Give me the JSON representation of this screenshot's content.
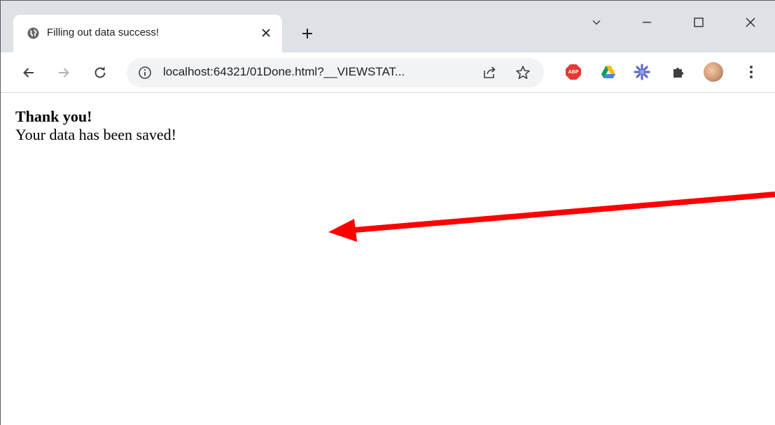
{
  "browser": {
    "tab": {
      "title": "Filling out data success!",
      "favicon": "globe-icon",
      "close_icon": "close-icon"
    },
    "new_tab_icon": "plus-icon",
    "window_controls": [
      "chevron-down-icon",
      "minimize-icon",
      "maximize-icon",
      "close-icon"
    ],
    "toolbar": {
      "back_icon": "back-arrow-icon",
      "forward_icon": "forward-arrow-icon",
      "reload_icon": "reload-icon",
      "address": "localhost:64321/01Done.html?__VIEWSTAT...",
      "site_info_icon": "info-icon",
      "share_icon": "share-icon",
      "bookmark_icon": "star-icon",
      "extensions": [
        {
          "name": "adblock-plus-icon",
          "label": "ABP"
        },
        {
          "name": "google-drive-icon"
        },
        {
          "name": "sparkle-extension-icon"
        },
        {
          "name": "puzzle-extensions-icon"
        },
        {
          "name": "profile-avatar"
        }
      ],
      "menu_icon": "kebab-menu-icon"
    }
  },
  "page": {
    "heading": "Thank you!",
    "message": "Your data has been saved!"
  },
  "annotation": {
    "arrow_color": "#ff0000"
  }
}
